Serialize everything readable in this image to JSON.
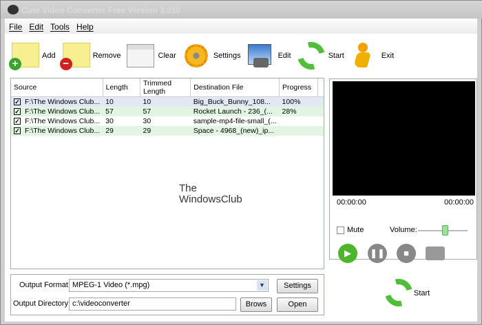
{
  "window": {
    "title": "Cute Video Converter Free Version 3.010"
  },
  "menu": [
    "File",
    "Edit",
    "Tools",
    "Help"
  ],
  "toolbar": {
    "add": "Add",
    "remove": "Remove",
    "clear": "Clear",
    "settings": "Settings",
    "edit": "Edit",
    "start": "Start",
    "exit": "Exit"
  },
  "table": {
    "headers": [
      "Source",
      "Length",
      "Trimmed Length",
      "Destination File",
      "Progress"
    ],
    "rows": [
      [
        "F:\\The Windows Club...",
        "10",
        "10",
        "Big_Buck_Bunny_108...",
        "100%"
      ],
      [
        "F:\\The Windows Club...",
        "57",
        "57",
        "Rocket Launch - 236_(...",
        "28%"
      ],
      [
        "F:\\The Windows Club...",
        "30",
        "30",
        "sample-mp4-file-small_(...",
        ""
      ],
      [
        "F:\\The Windows Club...",
        "29",
        "29",
        "Space - 4968_(new)_ip...",
        ""
      ]
    ]
  },
  "watermark": {
    "line1": "The",
    "line2": "WindowsClub"
  },
  "player": {
    "time_start": "00:00:00",
    "time_end": "00:00:00",
    "mute": "Mute",
    "volume_label": "Volume:",
    "volume": 0.55
  },
  "output": {
    "format_label": "Output Format:",
    "format_value": "MPEG-1 Video (*.mpg)",
    "dir_label": "Output Directory:",
    "dir_value": "c:\\videoconverter",
    "settings": "Settings",
    "browse": "Brows",
    "open": "Open"
  },
  "start": "Start"
}
